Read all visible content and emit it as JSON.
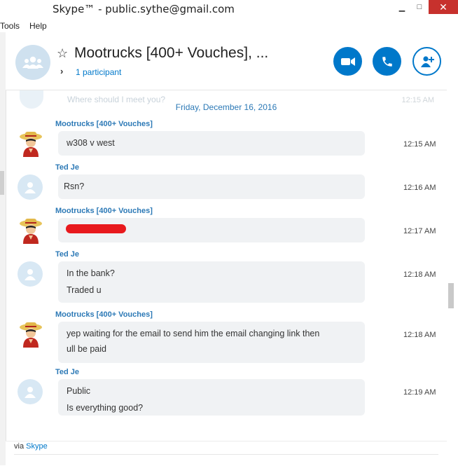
{
  "window": {
    "title": "Skype™ - public.sythe@gmail.com",
    "minimize": "▁",
    "maximize": "□",
    "close": "✕"
  },
  "menu": {
    "items": [
      "Tools",
      "Help"
    ]
  },
  "header": {
    "conversation_title": "Mootrucks [400+ Vouches], ...",
    "participants": "1 participant",
    "icons": {
      "favorite": "star-icon",
      "video": "video-icon",
      "call": "phone-icon",
      "add": "add-person-icon"
    },
    "accent": "#0078ca"
  },
  "chat": {
    "ghost_message": "Where should I meet you?",
    "ghost_time": "12:15 AM",
    "date_divider": "Friday, December 16, 2016",
    "messages": [
      {
        "sender": "Mootrucks [400+ Vouches]",
        "lines": [
          "w308 v west"
        ],
        "time": "12:15 AM"
      },
      {
        "sender": "Ted Je",
        "lines": [
          "Rsn?"
        ],
        "time": "12:16 AM"
      },
      {
        "sender": "Mootrucks [400+ Vouches]",
        "lines": [
          ""
        ],
        "redacted": true,
        "time": "12:17 AM"
      },
      {
        "sender": "Ted Je",
        "lines": [
          "In the bank?",
          "Traded u"
        ],
        "time": "12:18 AM"
      },
      {
        "sender": "Mootrucks [400+ Vouches]",
        "lines": [
          "yep waiting for the email to send him the email changing link then",
          "ull be paid"
        ],
        "time": "12:18 AM"
      },
      {
        "sender": "Ted Je",
        "lines": [
          "Public",
          "Is everything good?"
        ],
        "time": "12:19 AM"
      }
    ]
  },
  "footer": {
    "via_prefix": "via",
    "via_link": "Skype"
  }
}
